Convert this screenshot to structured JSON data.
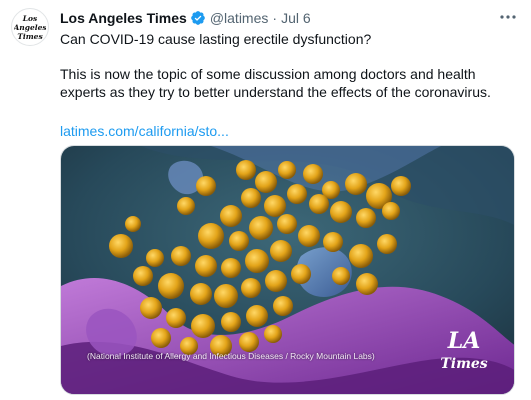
{
  "tweet": {
    "author_name": "Los Angeles Times",
    "handle": "@latimes",
    "separator": "·",
    "date": "Jul 6",
    "avatar_logo": "Los Angeles Times",
    "verified_icon": "verified-badge-icon",
    "more_icon": "more-horizontal-icon",
    "text_line1": "Can COVID-19 cause lasting erectile dysfunction?",
    "text_paragraph2": "This is now the topic of some discussion among doctors and health experts as they try to better understand the effects of the coronavirus.",
    "link_text": "latimes.com/california/sto...",
    "media": {
      "caption": "(National Institute of Allergy and Infectious Diseases / Rocky Mountain Labs)",
      "watermark": "LA Times"
    }
  },
  "colors": {
    "link": "#1d9bf0",
    "verified": "#1d9bf0",
    "secondary_text": "#536471",
    "virus_particles": "#e0a418",
    "cell_purple": "#8d3fb0",
    "background_teal": "#2f5a6b"
  }
}
